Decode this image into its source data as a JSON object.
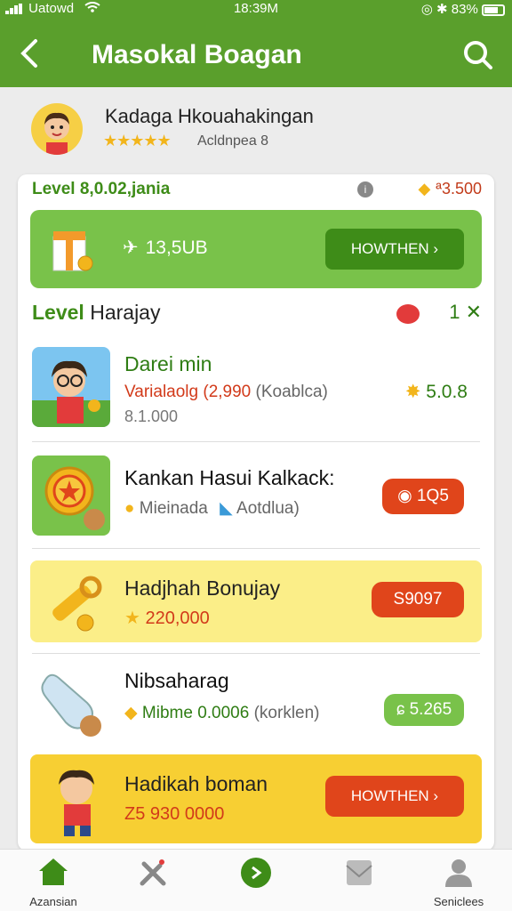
{
  "status_bar": {
    "carrier": "Uatowd",
    "time": "18:39M",
    "battery": "83%"
  },
  "header": {
    "title": "Masokal Boagan",
    "icons": {
      "back": "chevron-left-icon",
      "search": "search-icon"
    }
  },
  "profile": {
    "name": "Kadaga Hkouahakingan",
    "rating_stars": "★★★★★",
    "rating_label": "Acldnpea 8"
  },
  "level_header": {
    "label": "Level 8,0.02,jania",
    "coins": "ª3.500"
  },
  "promo": {
    "value": "13,5UB",
    "button_label": "HOWTHEN ›"
  },
  "section": {
    "title_bold": "Level",
    "title_rest": " Harajay",
    "count": "1 ✕"
  },
  "items": [
    {
      "title": "Darei min",
      "subtitle_a": "Varialaolg (2,990",
      "subtitle_b": " (Koablca)",
      "amount": "8.1.000",
      "badge": "5.0.8"
    },
    {
      "title": "Kankan  Hasui Kalkack:",
      "subtitle_a": "Mieinada",
      "subtitle_b": "Aotdlua)",
      "badge": "1Q5"
    },
    {
      "title": "Hadjhah Bonujay",
      "amount": "220,000",
      "badge": "S9097"
    },
    {
      "title": "Nibsaharag",
      "subtitle_a": "Mibme 0.0006",
      "subtitle_b": " (korklen)",
      "badge": "5.265"
    },
    {
      "title": "Hadikah boman",
      "amount": "Z5 930 0000",
      "button_label": "HOWTHEN ›"
    }
  ],
  "bottom_nav": [
    {
      "label": "Azansian",
      "icon": "home-icon"
    },
    {
      "label": "",
      "icon": "tools-icon"
    },
    {
      "label": "",
      "icon": "play-icon"
    },
    {
      "label": "",
      "icon": "inbox-icon"
    },
    {
      "label": "Seniclees",
      "icon": "profile-icon"
    }
  ],
  "colors": {
    "brand_green": "#5a9f2c",
    "light_green": "#79c24a",
    "dark_green": "#3e8c18",
    "accent_red": "#e0451b",
    "yellow": "#fbee88",
    "gold": "#f7cf33"
  }
}
